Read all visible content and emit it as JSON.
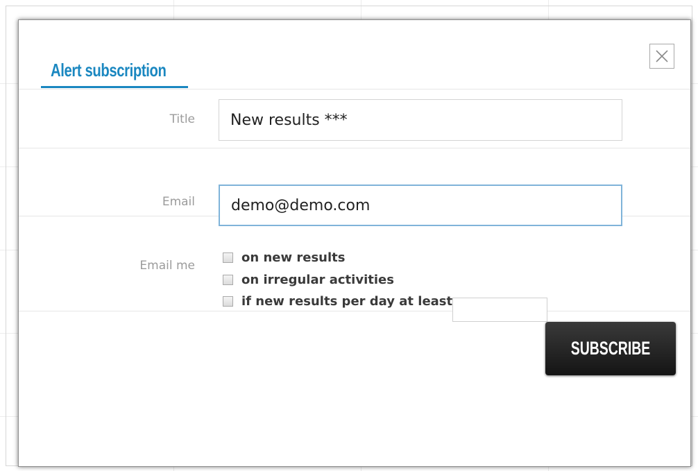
{
  "dialog": {
    "title": "Alert subscription",
    "close_icon": "close-icon",
    "accent_color": "#1a87c0"
  },
  "form": {
    "title_label": "Title",
    "title_value": "New results ***",
    "email_label": "Email",
    "email_value": "demo@demo.com",
    "email_me_label": "Email me",
    "options": [
      {
        "label": "on new results",
        "checked": false
      },
      {
        "label": "on irregular activities",
        "checked": false
      },
      {
        "label": "if new results per day at least",
        "checked": false
      }
    ],
    "per_day_value": ""
  },
  "actions": {
    "subscribe_label": "SUBSCRIBE"
  }
}
